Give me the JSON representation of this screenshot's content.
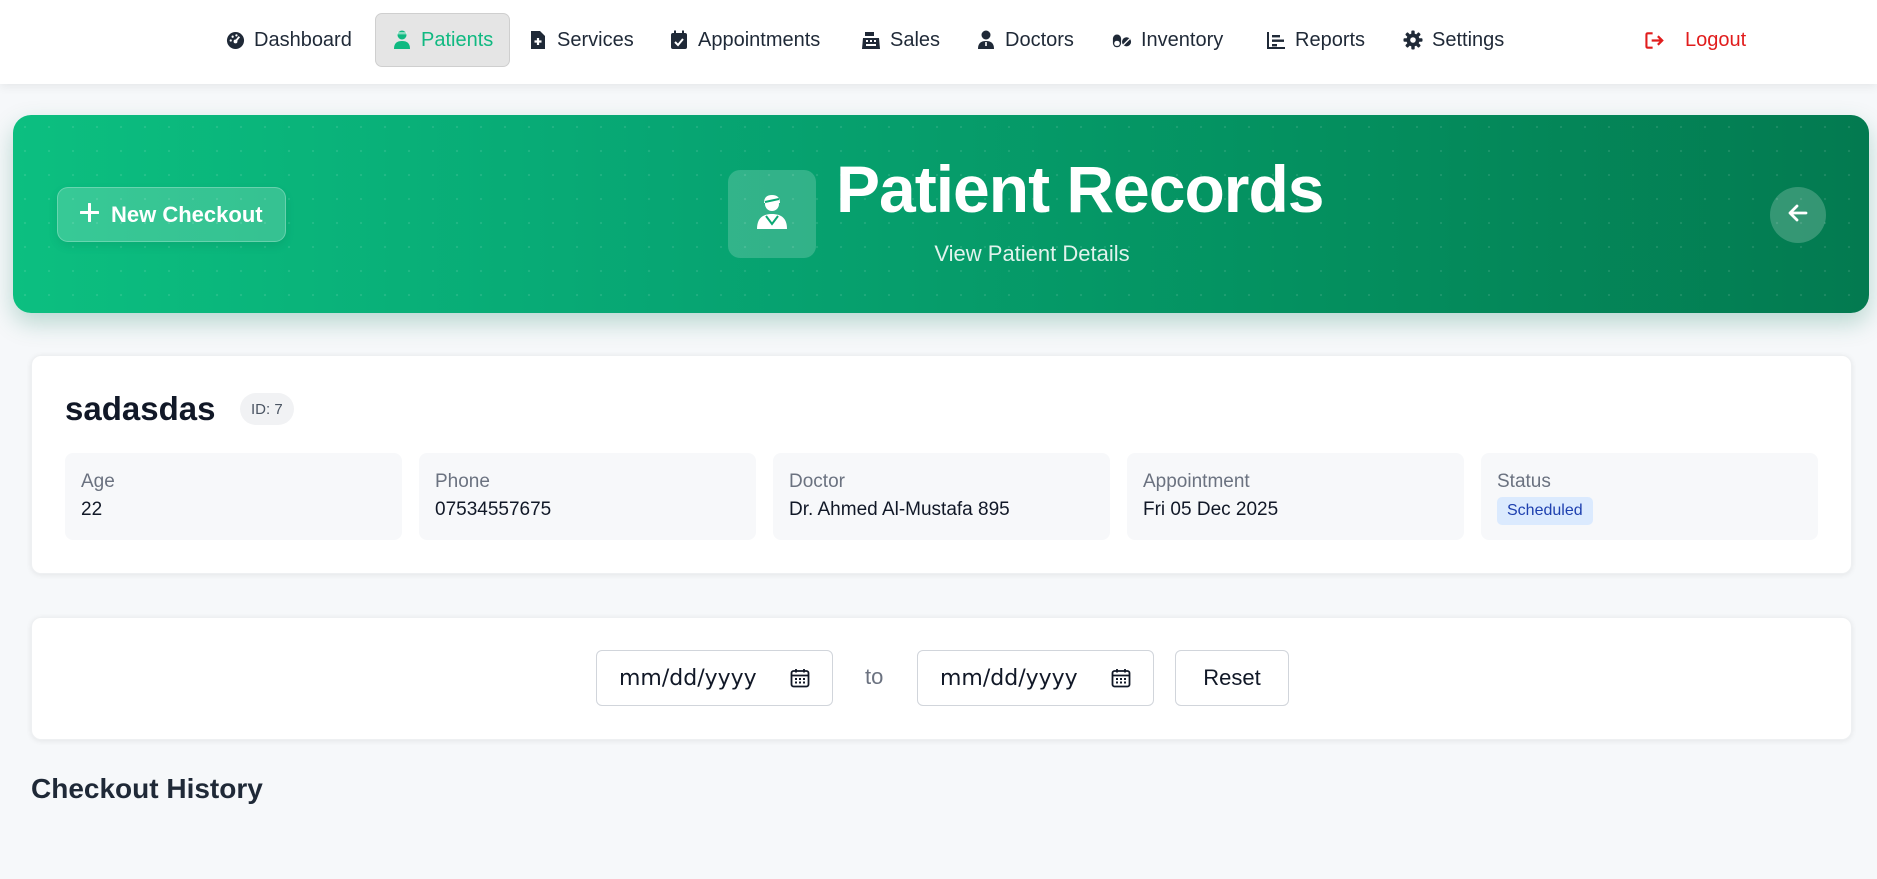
{
  "nav": {
    "items": [
      {
        "label": "Dashboard",
        "icon": "gauge-icon"
      },
      {
        "label": "Patients",
        "icon": "user-doctor-icon",
        "active": true
      },
      {
        "label": "Services",
        "icon": "file-medical-icon"
      },
      {
        "label": "Appointments",
        "icon": "calendar-check-icon"
      },
      {
        "label": "Sales",
        "icon": "cash-register-icon"
      },
      {
        "label": "Doctors",
        "icon": "user-doctor-icon"
      },
      {
        "label": "Inventory",
        "icon": "pills-icon"
      },
      {
        "label": "Reports",
        "icon": "chart-bar-icon"
      },
      {
        "label": "Settings",
        "icon": "gear-icon"
      }
    ],
    "logout_label": "Logout"
  },
  "hero": {
    "new_checkout_label": "New Checkout",
    "title": "Patient Records",
    "subtitle": "View Patient Details"
  },
  "patient": {
    "name": "sadasdas",
    "id_label": "ID: 7",
    "fields": [
      {
        "label": "Age",
        "value": "22"
      },
      {
        "label": "Phone",
        "value": "07534557675"
      },
      {
        "label": "Doctor",
        "value": "Dr. Ahmed Al-Mustafa 895"
      },
      {
        "label": "Appointment",
        "value": "Fri 05 Dec 2025"
      },
      {
        "label": "Status",
        "value": "Scheduled"
      }
    ]
  },
  "filter": {
    "from_placeholder": "mm/dd/yyyy",
    "to_label": "to",
    "to_placeholder": "mm/dd/yyyy",
    "reset_label": "Reset"
  },
  "history": {
    "title": "Checkout History"
  },
  "colors": {
    "accent": "#10b981",
    "hero_start": "#0cbf80",
    "hero_end": "#037a50",
    "logout": "#e11d1d",
    "status_bg": "#dbeafe",
    "status_text": "#1e40af"
  }
}
